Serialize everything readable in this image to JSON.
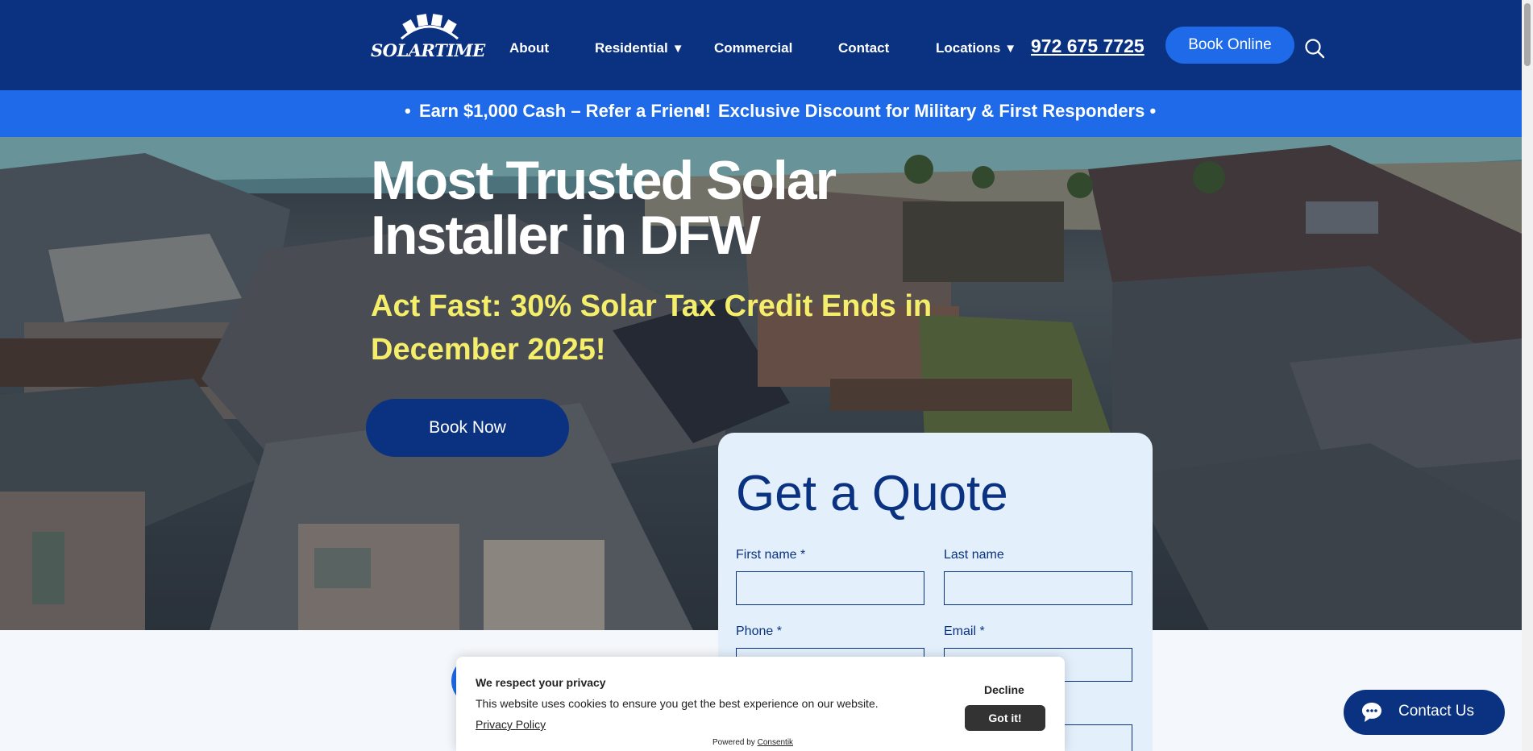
{
  "header": {
    "logo_text": "SOLARTIME",
    "nav": {
      "about": "About",
      "residential": "Residential",
      "commercial": "Commercial",
      "contact": "Contact",
      "locations": "Locations"
    },
    "caret": "▼",
    "phone": "972 675 7725",
    "book_online": "Book Online",
    "search_icon": "search-icon"
  },
  "promo": {
    "bullet": "•",
    "item1": "Earn $1,000 Cash – Refer a Friend!",
    "item2": "Exclusive Discount for Military & First Responders •"
  },
  "hero": {
    "title_line1": "Most Trusted Solar",
    "title_line2": "Installer in DFW",
    "subtitle_line1": "Act Fast: 30% Solar Tax Credit Ends in",
    "subtitle_line2": "December 2025!",
    "cta": "Book Now"
  },
  "quote_form": {
    "title": "Get a Quote",
    "first_name_label": "First name *",
    "last_name_label": "Last name",
    "phone_label": "Phone *",
    "email_label": "Email *",
    "first_name_value": "",
    "last_name_value": "",
    "phone_value": "",
    "email_value": ""
  },
  "cookie_banner": {
    "title": "We respect your privacy",
    "text": "This website uses cookies to ensure you get the best experience on our website.",
    "policy_link": "Privacy Policy",
    "decline": "Decline",
    "accept": "Got it!",
    "powered_by": "Powered by",
    "powered_by_brand": "Consentik"
  },
  "contact_widget": {
    "label": "Contact Us",
    "icon": "chat-bubble-icon"
  },
  "colors": {
    "header_bg": "#0a3281",
    "promo_bg": "#1e6ae8",
    "accent_yellow": "#f5ee6a",
    "form_bg": "#e3f0fc"
  }
}
